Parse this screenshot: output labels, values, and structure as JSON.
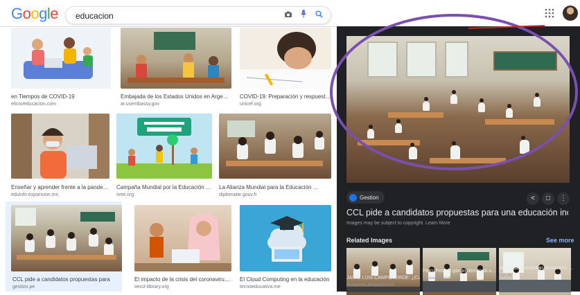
{
  "header": {
    "logo": {
      "letters": [
        "G",
        "o",
        "o",
        "g",
        "l",
        "e"
      ],
      "colors": [
        "#4285F4",
        "#EA4335",
        "#FBBC05",
        "#4285F4",
        "#34A853",
        "#EA4335"
      ]
    },
    "search_value": "educacion",
    "icons": [
      "camera-icon",
      "mic-icon",
      "search-icon",
      "apps-icon",
      "avatar"
    ]
  },
  "results": [
    {
      "caption": "en Tiempos de COVID-19",
      "source": "elicoveducacion.com"
    },
    {
      "caption": "Embajada de los Estados Unidos en Argentina",
      "source": "ar.usembassy.gov"
    },
    {
      "caption": "COVID-19: Preparación y respuesta ...",
      "source": "unicef.org"
    },
    {
      "caption": "Enseñar y aprender frente a la pandemia",
      "source": "eduinfo.expansion.mx"
    },
    {
      "caption": "Campaña Mundial por la Educación | Inte...",
      "source": "inee.org"
    },
    {
      "caption": "La Alianza Mundial para la Educación ...",
      "source": "diplomatie.gouv.fr"
    },
    {
      "caption": "CCL pide a candidatos propuestas para",
      "source": "gestion.pe"
    },
    {
      "caption": "El impacto de la crisis del coronavirus ...",
      "source": "oecd-ilibrary.org"
    },
    {
      "caption": "El Cloud Computing en la educación",
      "source": "tecnoeducativa.me"
    }
  ],
  "panel": {
    "source_label": "Gestion",
    "title": "CCL pide a candidatos propuestas para una educación inclusiva ...",
    "note": "Images may be subject to copyright. Learn More",
    "related_heading": "Related Images",
    "see_more": "See more",
    "related": [
      {
        "caption": "JAIME LUIS CAMPOVERDE: ¿Cu...",
        "source": "jluisgarcia.blogspot.com"
      },
      {
        "caption": "Perú: Peores ganan demanda o...",
        "source": "educacion.com"
      },
      {
        "caption": "Arequipa: Presentan resultados ...",
        "source": "rpp.pe"
      }
    ]
  },
  "colors": {
    "accent": "#1a73e8",
    "annotation": "#7b4fb0",
    "panel_bg": "#202124"
  }
}
